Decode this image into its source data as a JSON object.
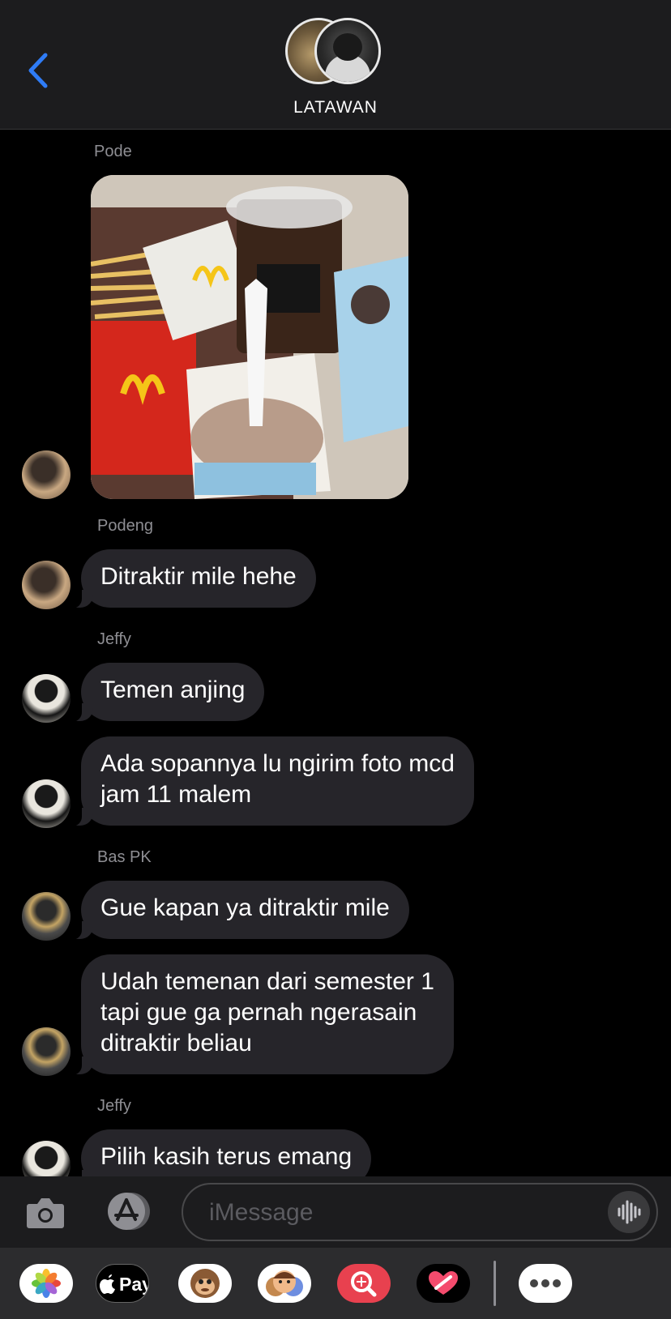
{
  "header": {
    "title": "LATAWAN",
    "back_icon": "chevron-left-icon",
    "accent_color": "#2f7cf6"
  },
  "messages": [
    {
      "sender": "Pode",
      "type": "photo",
      "photo_description_icon": "photo-icon"
    },
    {
      "sender": "Podeng",
      "text": "Ditraktir mile hehe"
    },
    {
      "sender": "Jeffy",
      "text": "Temen anjing"
    },
    {
      "sender": "",
      "text": "Ada sopannya lu ngirim foto mcd jam 11 malem"
    },
    {
      "sender": "Bas PK",
      "text": "Gue kapan ya ditraktir mile"
    },
    {
      "sender": "",
      "text": "Udah temenan dari semester 1 tapi gue ga pernah ngerasain ditraktir beliau"
    },
    {
      "sender": "Jeffy",
      "text": "Pilih kasih terus emang"
    }
  ],
  "senders": {
    "pode": "Pode",
    "podeng": "Podeng",
    "jeffy1": "Jeffy",
    "bas": "Bas PK",
    "jeffy2": "Jeffy"
  },
  "texts": {
    "m1": "Ditraktir mile hehe",
    "m2": "Temen anjing",
    "m3_line1": "Ada sopannya lu ngirim foto mcd",
    "m3_line2": "jam 11 malem",
    "m4": "Gue kapan ya ditraktir mile",
    "m5_line1": "Udah temenan dari semester 1",
    "m5_line2": "tapi gue ga pernah ngerasain",
    "m5_line3": "ditraktir beliau",
    "m6": "Pilih kasih terus emang"
  },
  "input": {
    "placeholder": "iMessage",
    "value": ""
  },
  "app_drawer": {
    "items": [
      {
        "name": "photos-app-icon"
      },
      {
        "name": "apple-pay-icon",
        "label": "Pay"
      },
      {
        "name": "memoji-monkey-icon"
      },
      {
        "name": "memoji-stickers-icon"
      },
      {
        "name": "image-search-icon"
      },
      {
        "name": "digital-touch-heart-icon"
      },
      {
        "name": "more-apps-icon"
      }
    ]
  }
}
